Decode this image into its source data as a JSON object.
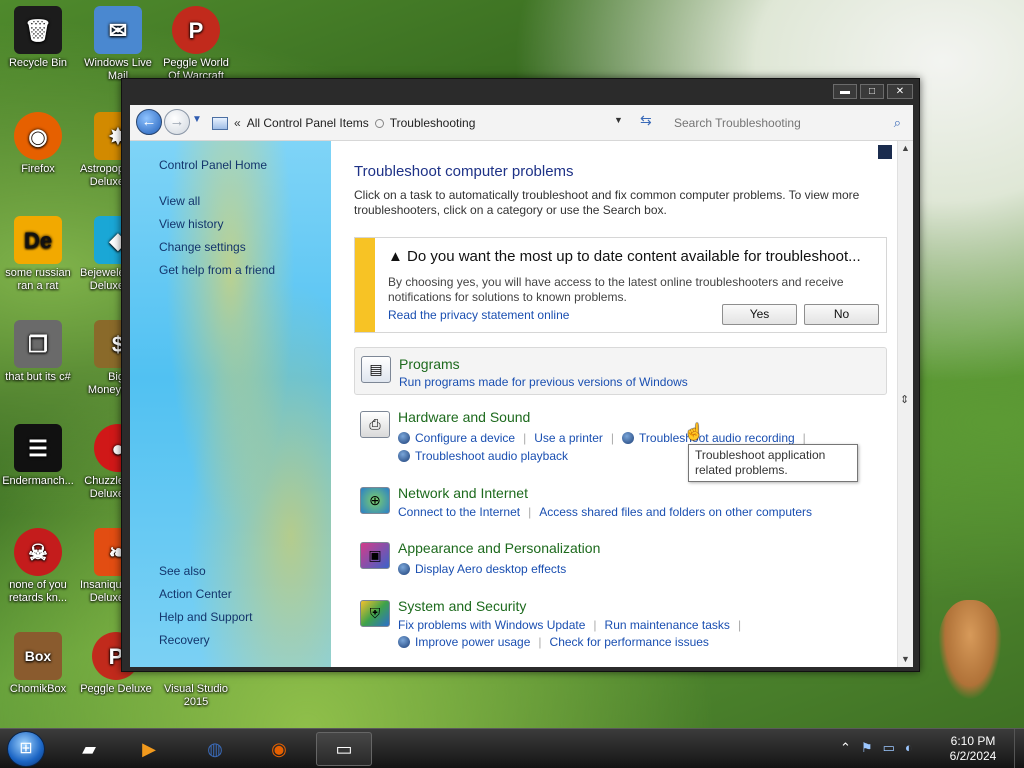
{
  "desktop": {
    "icons": [
      {
        "label": "Recycle Bin",
        "symbol": "🗑",
        "color": "#1c1c1c"
      },
      {
        "label": "Windows Live Mail",
        "symbol": "✉",
        "color": "#4a88d0"
      },
      {
        "label": "Peggle World Of Warcraft",
        "symbol": "P",
        "color": "#c12a1c"
      },
      {
        "label": "Firefox",
        "symbol": "◉",
        "color": "#e66000"
      },
      {
        "label": "Astropop Deluxe",
        "symbol": "✸",
        "color": "#d28a00"
      },
      {
        "label": "some russian ran a rat",
        "symbol": "De",
        "color": "#f2a900"
      },
      {
        "label": "Bejeweled Deluxe",
        "symbol": "◆",
        "color": "#1aa7d6"
      },
      {
        "label": "that but its c#",
        "symbol": "❐",
        "color": "#6a6a6a"
      },
      {
        "label": "Big Money! Deluxe",
        "symbol": "$",
        "color": "#8a6a2a"
      },
      {
        "label": "Endermanch...",
        "symbol": "☰",
        "color": "#111111"
      },
      {
        "label": "Chuzzle Deluxe",
        "symbol": "●",
        "color": "#d01818"
      },
      {
        "label": "none of you retards kn...",
        "symbol": "☠",
        "color": "#c41c1c"
      },
      {
        "label": "Insaniquarium Deluxe",
        "symbol": "❧",
        "color": "#e24d12"
      },
      {
        "label": "ChomikBox",
        "symbol": "Box",
        "color": "#8a5b2e"
      },
      {
        "label": "Peggle Deluxe",
        "symbol": "P",
        "color": "#c12a1c"
      },
      {
        "label": "Visual Studio 2015",
        "symbol": "∞",
        "color": "#68217a"
      }
    ]
  },
  "window": {
    "caption_buttons": {
      "minimize": "▬",
      "maximize": "□",
      "close": "✕"
    },
    "address": {
      "chevron": "«",
      "crumbs": [
        "All Control Panel Items",
        "Troubleshooting"
      ],
      "search_placeholder": "Search Troubleshooting"
    },
    "left_pane": {
      "home": "Control Panel Home",
      "links": [
        "View all",
        "View history",
        "Change settings",
        "Get help from a friend"
      ],
      "see_also_title": "See also",
      "see_also": [
        "Action Center",
        "Help and Support",
        "Recovery"
      ]
    },
    "main": {
      "title": "Troubleshoot computer problems",
      "intro": "Click on a task to automatically troubleshoot and fix common computer problems. To view more troubleshooters, click on a category or use the Search box.",
      "info_bar": {
        "title": "Do you want the most up to date content available for troubleshoot...",
        "text": "By choosing yes, you will have access to the latest online troubleshooters and receive notifications for solutions to known problems.",
        "privacy_link": "Read the privacy statement online",
        "yes": "Yes",
        "no": "No",
        "stripe_color": "#f7c325"
      },
      "categories": [
        {
          "title": "Programs",
          "links": [
            "Run programs made for previous versions of Windows"
          ]
        },
        {
          "title": "Hardware and Sound",
          "links": [
            "Configure a device",
            "Use a printer",
            "Troubleshoot audio recording",
            "Troubleshoot audio playback"
          ]
        },
        {
          "title": "Network and Internet",
          "links": [
            "Connect to the Internet",
            "Access shared files and folders on other computers"
          ]
        },
        {
          "title": "Appearance and Personalization",
          "links": [
            "Display Aero desktop effects"
          ]
        },
        {
          "title": "System and Security",
          "links": [
            "Fix problems with Windows Update",
            "Run maintenance tasks",
            "Improve power usage",
            "Check for performance issues"
          ]
        }
      ],
      "tooltip": "Troubleshoot application related problems."
    }
  },
  "taskbar": {
    "clock_time": "6:10 PM",
    "clock_date": "6/2/2024"
  },
  "colors": {
    "link": "#1a4fb1",
    "category_title": "#1d6a1d",
    "heading": "#1e3287"
  }
}
